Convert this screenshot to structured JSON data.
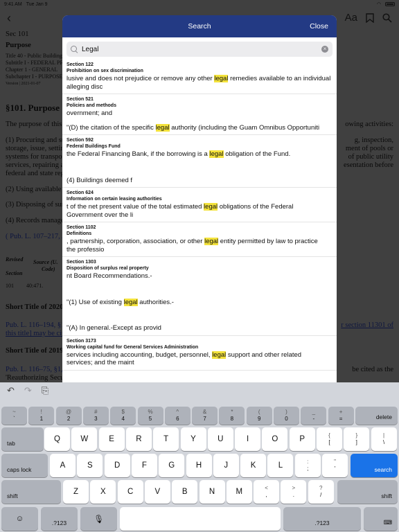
{
  "status": {
    "time": "9:41 AM",
    "date": "Tue Jan 9"
  },
  "nav": {
    "back": "‹",
    "title": "Sec 101",
    "font_icon": "Aa",
    "bookmark_icon": "bookmark-icon",
    "search_icon": "search-icon"
  },
  "doc": {
    "sec": "Sec 101",
    "purpose": "Purpose",
    "crumb1": "Title 40 - Public Buildings",
    "crumb2": "Subtitle I - FEDERAL PR",
    "crumb3": "Chapter 1 - GENERAL",
    "crumb4": "Subchapter I - PURPOSE",
    "version": "Version | 2021-01-07",
    "heading": "§101. Purpose",
    "p1": "The purpose of this s",
    "p1r": "owing activities:",
    "p2a": "(1) Procuring and su",
    "p2ar": "g, inspection,",
    "p2b": "storage, issue, settin",
    "p2br": "ment of pools or",
    "p2c": "systems for transpor",
    "p2cr": "of public utility",
    "p2d": "services, repairing an",
    "p2dr": "esentation before",
    "p2e": "federal and state reg",
    "p3": "(2) Using available p",
    "p4": "(3) Disposing of surp",
    "p5": "(4) Records manager",
    "cite": "( Pub. L. 107–217, A",
    "th1": "Revised",
    "th2": "Source (U.",
    "th3": "Code)",
    "th4": "Section",
    "td1": "101",
    "td2": "40:471.",
    "st2020": "Short Title of 2020",
    "st2020a": "Pub. L. 116–194, §1",
    "st2020ar": "r section 11301 of",
    "st2020b": "this title] may be cite",
    "st2019": "Short Title of 2019",
    "st2019a": "Pub. L. 116–75, §1,",
    "st2019ar": "be cited as the",
    "st2019b": "'Reauthorizing Secu"
  },
  "modal": {
    "title": "Search",
    "close": "Close",
    "query": "Legal",
    "placeholder": "Search"
  },
  "results": [
    {
      "section": "Section 122",
      "title": "Prohibition on sex discrimination",
      "lines": [
        {
          "pre": "lusive and does not prejudice or remove any other ",
          "hl": "legal",
          "post": " remedies available to an individual"
        },
        {
          "pre": "alleging disc",
          "hl": "",
          "post": ""
        }
      ]
    },
    {
      "section": "Section 521",
      "title": "Policies and methods",
      "lines": [
        {
          "pre": "overnment; and",
          "hl": "",
          "post": ""
        },
        {
          "pre": "\"(D) the citation of the specific ",
          "hl": "legal",
          "post": " authority (including the Guam Omnibus Opportuniti",
          "gap": 1
        }
      ]
    },
    {
      "section": "Section 592",
      "title": "Federal Buildings Fund",
      "lines": [
        {
          "pre": "the Federal Financing Bank, if the borrowing is a ",
          "hl": "legal",
          "post": " obligation of the Fund."
        },
        {
          "pre": "(4) Buildings deemed f",
          "hl": "",
          "post": "",
          "gap": 2
        }
      ]
    },
    {
      "section": "Section 624",
      "title": "Information on certain leasing authorities",
      "lines": [
        {
          "pre": "t of the net present value of the total estimated ",
          "hl": "legal",
          "post": " obligations of the Federal"
        },
        {
          "pre": "Government over the li",
          "hl": "",
          "post": ""
        }
      ]
    },
    {
      "section": "Section 1102",
      "title": "Definitions",
      "lines": [
        {
          "pre": ", partnership, corporation, association, or other ",
          "hl": "legal",
          "post": " entity permitted by law to practice"
        },
        {
          "pre": "the professio",
          "hl": "",
          "post": ""
        }
      ]
    },
    {
      "section": "Section 1303",
      "title": "Disposition of surplus real property",
      "lines": [
        {
          "pre": "nt Board Recommendations.-",
          "hl": "",
          "post": ""
        },
        {
          "pre": "\"(1) Use of existing ",
          "hl": "legal",
          "post": " authorities.-",
          "gap": 2
        },
        {
          "pre": "\"(A) In general.-Except as provid",
          "hl": "",
          "post": "",
          "gap": 2
        }
      ]
    },
    {
      "section": "Section 3173",
      "title": "Working capital fund for General Services Administration",
      "lines": [
        {
          "pre": "services including accounting, budget, personnel, ",
          "hl": "legal",
          "post": " support and other related"
        },
        {
          "pre": "services; and the maint",
          "hl": "",
          "post": ""
        }
      ]
    }
  ],
  "keyboard": {
    "undo": "↶",
    "redo": "↷",
    "paste": "⎘",
    "row1": [
      {
        "u": "~",
        "d": "`"
      },
      {
        "u": "!",
        "d": "1"
      },
      {
        "u": "@",
        "d": "2"
      },
      {
        "u": "#",
        "d": "3"
      },
      {
        "u": "$",
        "d": "4"
      },
      {
        "u": "%",
        "d": "5"
      },
      {
        "u": "^",
        "d": "6"
      },
      {
        "u": "&",
        "d": "7"
      },
      {
        "u": "*",
        "d": "8"
      },
      {
        "u": "(",
        "d": "9"
      },
      {
        "u": ")",
        "d": "0"
      },
      {
        "u": "_",
        "d": "-"
      },
      {
        "u": "+",
        "d": "="
      }
    ],
    "delete": "delete",
    "tab": "tab",
    "row2": [
      "Q",
      "W",
      "E",
      "R",
      "T",
      "Y",
      "U",
      "I",
      "O",
      "P"
    ],
    "row2p": [
      {
        "u": "{",
        "d": "["
      },
      {
        "u": "}",
        "d": "]"
      },
      {
        "u": "|",
        "d": "\\"
      }
    ],
    "caps": "caps lock",
    "row3": [
      "A",
      "S",
      "D",
      "F",
      "G",
      "H",
      "J",
      "K",
      "L"
    ],
    "row3p": [
      {
        "u": ":",
        "d": ";"
      },
      {
        "u": "\"",
        "d": "'"
      }
    ],
    "search": "search",
    "shift": "shift",
    "row4": [
      "Z",
      "X",
      "C",
      "V",
      "B",
      "N",
      "M"
    ],
    "row4p": [
      {
        "u": "<",
        "d": ","
      },
      {
        "u": ">",
        "d": "."
      },
      {
        "u": "?",
        "d": "/"
      }
    ],
    "emoji": "☺",
    "num": ".?123",
    "mic": "🎙",
    "hide": "⌨"
  }
}
